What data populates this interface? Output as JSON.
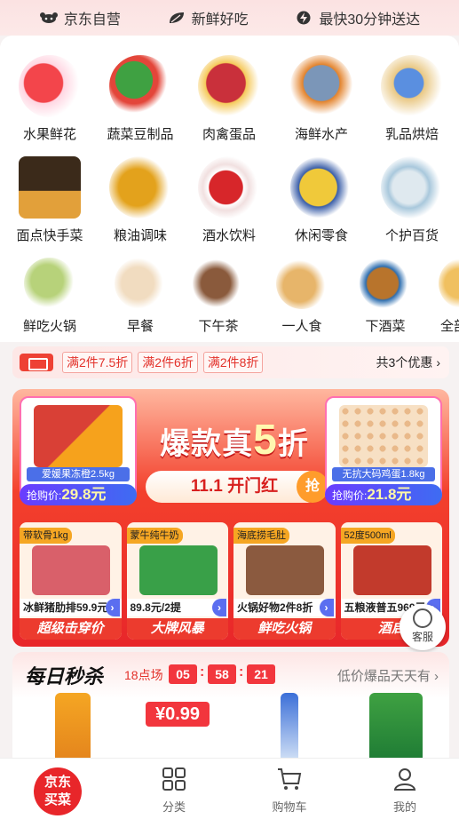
{
  "top_bar": {
    "promises": [
      {
        "icon": "jd-dog-icon",
        "label": "京东自营"
      },
      {
        "icon": "leaf-icon",
        "label": "新鲜好吃"
      },
      {
        "icon": "lightning-icon",
        "label": "最快30分钟送达"
      }
    ]
  },
  "categories": {
    "row1": [
      {
        "label": "水果鲜花",
        "color": "#f3454b"
      },
      {
        "label": "蔬菜豆制品",
        "color": "#3fa142"
      },
      {
        "label": "肉禽蛋品",
        "color": "#c9303b"
      },
      {
        "label": "海鲜水产",
        "color": "#7b96b8"
      },
      {
        "label": "乳品烘焙",
        "color": "#e9c884"
      }
    ],
    "row2": [
      {
        "label": "面点快手菜",
        "color": "#3b2a1a"
      },
      {
        "label": "粮油调味",
        "color": "#e3a21c"
      },
      {
        "label": "酒水饮料",
        "color": "#d7262a"
      },
      {
        "label": "休闲零食",
        "color": "#f0c93a"
      },
      {
        "label": "个护百货",
        "color": "#a9c8dc"
      }
    ],
    "row3": [
      {
        "label": "鲜吃火锅",
        "color": "#b7d27a"
      },
      {
        "label": "早餐",
        "color": "#f1dcc0"
      },
      {
        "label": "下午茶",
        "color": "#8a5a3c"
      },
      {
        "label": "一人食",
        "color": "#e7b56a"
      },
      {
        "label": "下酒菜",
        "color": "#b8742c"
      },
      {
        "label": "全部",
        "color": "#f0c060"
      }
    ]
  },
  "coupons": {
    "tags": [
      "满2件7.5折",
      "满2件6折",
      "满2件8折"
    ],
    "more": "共3个优惠"
  },
  "banner": {
    "title_prefix": "爆款真",
    "title_number": "5",
    "title_suffix": "折",
    "subtitle": "11.1 开门红",
    "grab": "抢",
    "left_card": {
      "name": "爱媛果冻橙2.5kg",
      "price_label": "抢购价:",
      "price": "29.8元"
    },
    "right_card": {
      "name": "无抗大码鸡蛋1.8kg",
      "price_label": "抢购价:",
      "price": "21.8元"
    },
    "products": [
      {
        "name": "带软骨1kg",
        "price": "冰鲜猪肋排59.9元",
        "slogan": "超级击穿价",
        "color": "#d9606a"
      },
      {
        "name": "蒙牛纯牛奶",
        "price": "89.8元/2提",
        "slogan": "大牌风暴",
        "color": "#39a048"
      },
      {
        "name": "海底捞毛肚",
        "price": "火锅好物2件8折",
        "slogan": "鲜吃火锅",
        "color": "#8b5a3f"
      },
      {
        "name": "52度500ml",
        "price": "五粮液普五969元",
        "slogan": "酒启",
        "color": "#c23a2c"
      }
    ]
  },
  "service": {
    "label": "客服"
  },
  "flash_sale": {
    "title": "每日秒杀",
    "session": "18点场",
    "hours": "05",
    "minutes": "58",
    "seconds": "21",
    "more": "低价爆品天天有",
    "price": "¥0.99"
  },
  "tabbar": {
    "home": "京东\n买菜",
    "home_line1": "京东",
    "home_line2": "买菜",
    "tabs": [
      {
        "label": "分类"
      },
      {
        "label": "购物车"
      },
      {
        "label": "我的"
      }
    ]
  },
  "colors": {
    "brand_red": "#e8262a",
    "accent_blue": "#4b6fe8"
  }
}
